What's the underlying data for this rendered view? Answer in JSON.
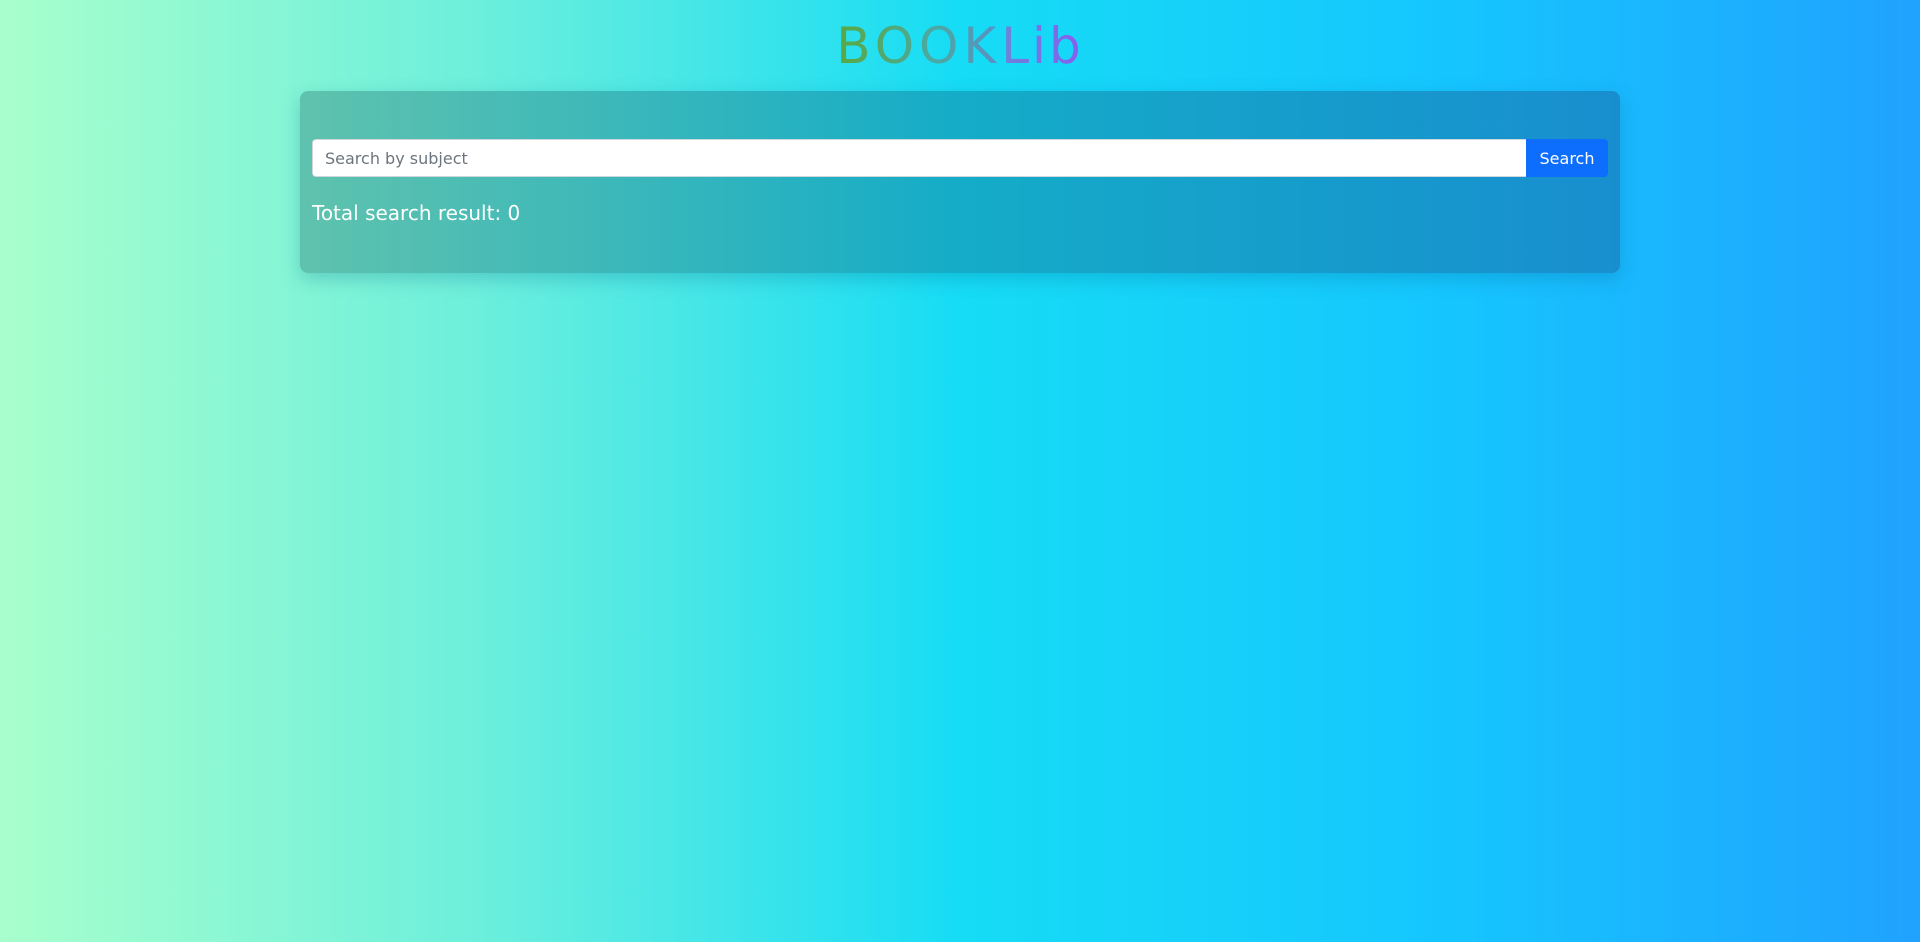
{
  "brand": {
    "part1": "BOOK",
    "part2": "Lib"
  },
  "search": {
    "placeholder": "Search by subject",
    "value": "",
    "button_label": "Search"
  },
  "results": {
    "label": "Total search result: ",
    "count": "0"
  },
  "colors": {
    "button": "#0d6efd",
    "text": "#ffffff"
  }
}
